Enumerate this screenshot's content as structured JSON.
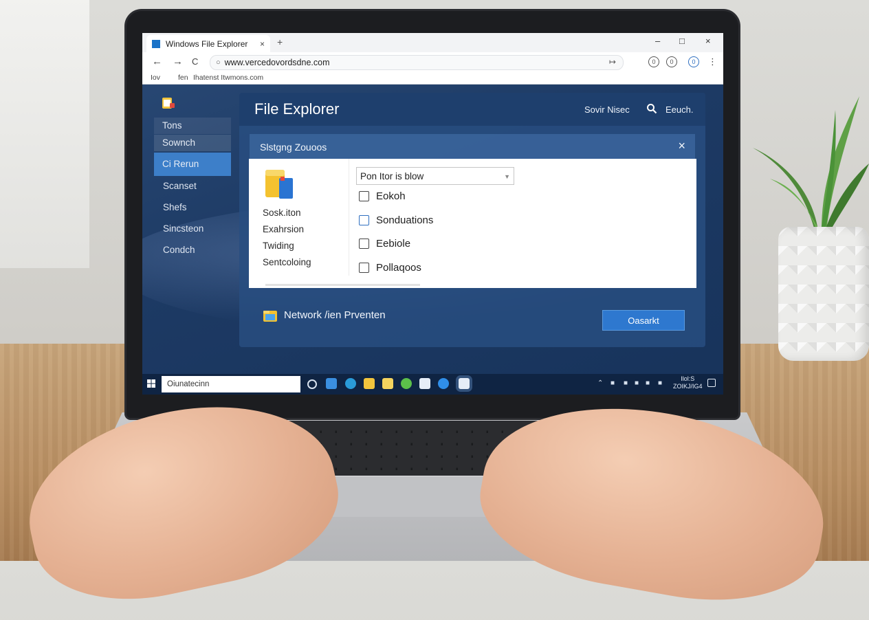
{
  "browser": {
    "tab_title": "Windows File Explorer",
    "tab_close": "×",
    "new_tab": "+",
    "window_controls": [
      "–",
      "□",
      "×"
    ],
    "nav": {
      "back": "←",
      "forward": "→",
      "reload": "C"
    },
    "url": "www.vercedovordsdne.com",
    "bookmarks": [
      "Iov",
      "fen",
      "Ihatenst Itwmons.com"
    ]
  },
  "sidebar": {
    "items": [
      {
        "label": "Tons",
        "state": "hl1"
      },
      {
        "label": "Sownch",
        "state": "hl2"
      },
      {
        "label": "Ci Rerun",
        "state": "active"
      }
    ],
    "plain_items": [
      "Scanset",
      "Shefs",
      "Sincsteon",
      "Condch"
    ]
  },
  "panel": {
    "title": "File Explorer",
    "sort_label": "Sovir Nisec",
    "search_label": "Eeuch."
  },
  "dialog": {
    "title": "Slstgng Zouoos",
    "close": "×",
    "left_options": [
      "Sosk.iton",
      "Exahrsion",
      "Twiding",
      "Sentcoloing"
    ],
    "select_value": "Pon Itor is blow",
    "checkboxes": [
      {
        "label": "Eokoh",
        "accent": false
      },
      {
        "label": "Sonduations",
        "accent": true
      },
      {
        "label": "Eebiole",
        "accent": false
      },
      {
        "label": "Pollaqoos",
        "accent": false
      }
    ]
  },
  "footer": {
    "label": "Network /ien Prventen",
    "button": "Oasarkt"
  },
  "taskbar": {
    "search_text": "Oiunatecinn",
    "clock_line1": "Ilol:S",
    "clock_line2": "ZOIKJ/IG4"
  },
  "colors": {
    "accent": "#2e78cf",
    "screen_bg": "#1d3a64",
    "active_sidebar": "#3d7fc9"
  }
}
